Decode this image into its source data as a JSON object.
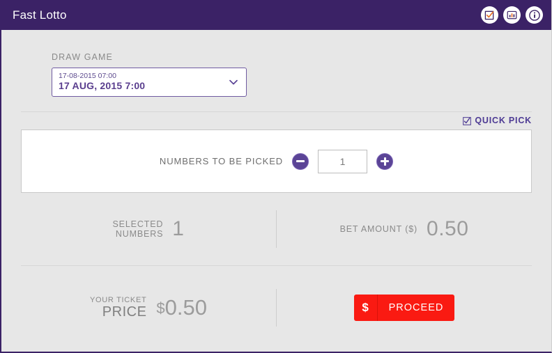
{
  "header": {
    "title": "Fast Lotto",
    "icons": [
      {
        "name": "ticket-check-icon",
        "glyph": "checkbox-check"
      },
      {
        "name": "results-chart-icon",
        "glyph": "bar-chart"
      },
      {
        "name": "info-icon",
        "glyph": "i"
      }
    ],
    "bg_color": "#3b2266"
  },
  "draw_game": {
    "label": "DRAW GAME",
    "selected_code": "17-08-2015 07:00",
    "selected_display": "17 AUG, 2015 7:00"
  },
  "quick_pick": {
    "label": "QUICK PICK",
    "checked": true,
    "color": "#4d3a94"
  },
  "picker": {
    "label": "NUMBERS TO BE PICKED",
    "value": "1",
    "decrement_label": "−",
    "increment_label": "+"
  },
  "summary": {
    "selected_numbers": {
      "label_line1": "SELECTED",
      "label_line2": "NUMBERS",
      "value": "1"
    },
    "bet_amount": {
      "label": "BET AMOUNT ($)",
      "value": "0.50"
    }
  },
  "price": {
    "label_small": "YOUR TICKET",
    "label_big": "PRICE",
    "currency": "$",
    "value": "0.50",
    "proceed": {
      "icon_label": "$",
      "label": "PROCEED",
      "color": "#fa1a12"
    }
  }
}
